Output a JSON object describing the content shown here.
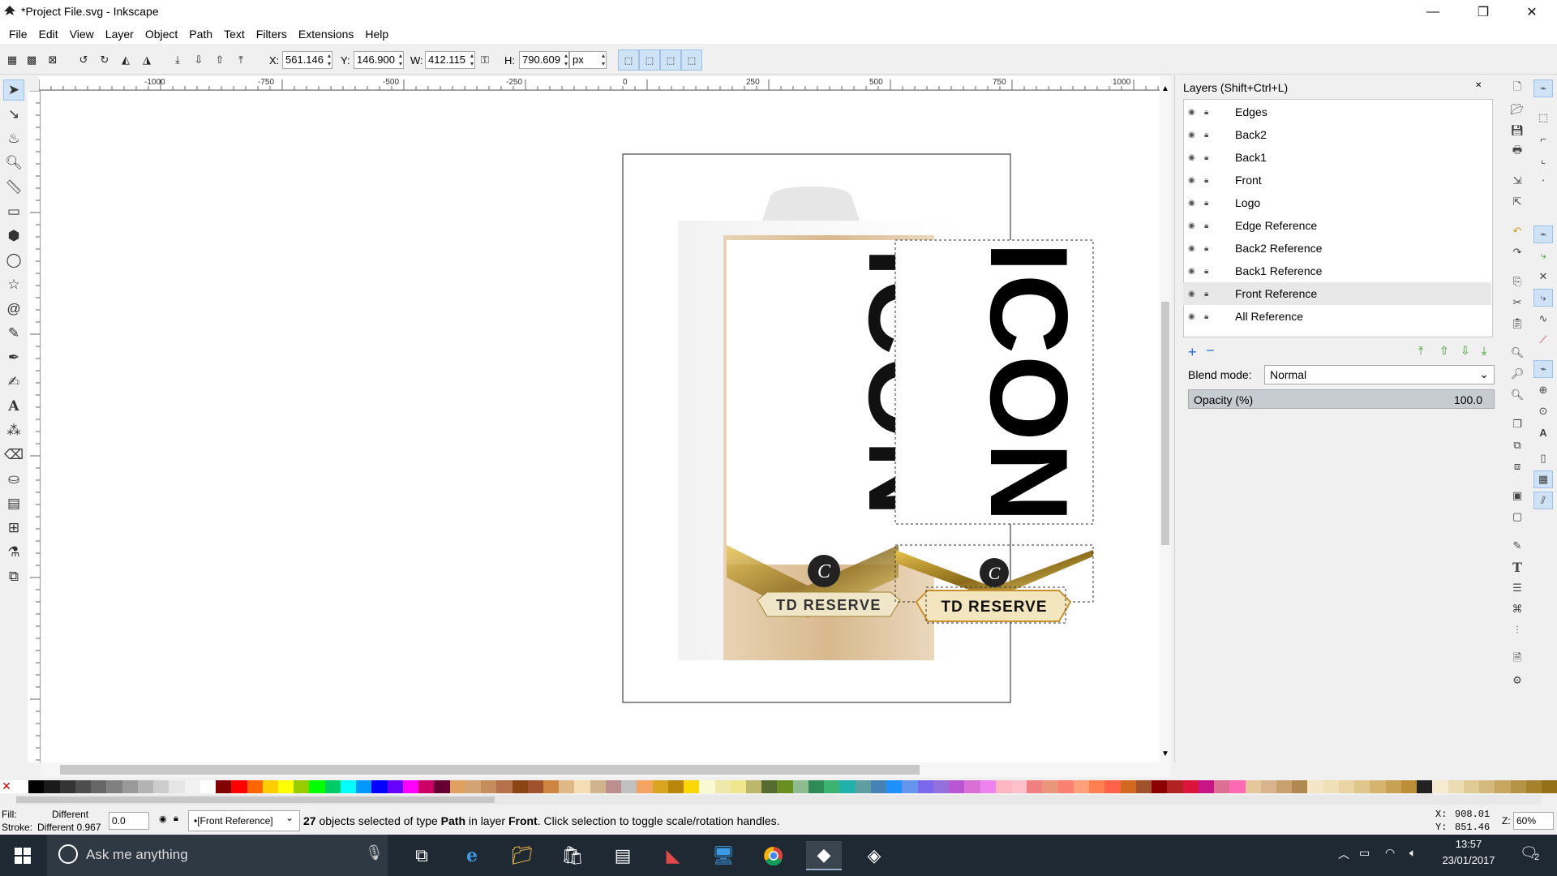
{
  "window": {
    "title": "*Project File.svg - Inkscape",
    "minimize": "—",
    "maximize": "❐",
    "close": "✕"
  },
  "menu": [
    "File",
    "Edit",
    "View",
    "Layer",
    "Object",
    "Path",
    "Text",
    "Filters",
    "Extensions",
    "Help"
  ],
  "tool_controls": {
    "x_label": "X:",
    "x_value": "561.146",
    "y_label": "Y:",
    "y_value": "146.900",
    "w_label": "W:",
    "w_value": "412.115",
    "h_label": "H:",
    "h_value": "790.609",
    "unit": "px"
  },
  "ruler": {
    "h_ticks": [
      "-1000",
      "-750",
      "-500",
      "-250",
      "0",
      "250",
      "500",
      "750",
      "1000"
    ],
    "v_ticks": [
      "0",
      "100",
      "200",
      "300",
      "400",
      "500",
      "600",
      "700",
      "800",
      "900"
    ]
  },
  "artwork": {
    "left_word": "ICON",
    "left_label": "TD RESERVE",
    "right_word": "ICON",
    "right_label": "TD RESERVE",
    "badge": "C"
  },
  "layers_panel": {
    "title": "Layers (Shift+Ctrl+L)",
    "layers": [
      {
        "name": "Edges",
        "selected": false
      },
      {
        "name": "Back2",
        "selected": false
      },
      {
        "name": "Back1",
        "selected": false
      },
      {
        "name": "Front",
        "selected": false
      },
      {
        "name": "Logo",
        "selected": false
      },
      {
        "name": "Edge Reference",
        "selected": false
      },
      {
        "name": "Back2 Reference",
        "selected": false
      },
      {
        "name": "Back1 Reference",
        "selected": false
      },
      {
        "name": "Front Reference",
        "selected": true
      },
      {
        "name": "All Reference",
        "selected": false
      }
    ],
    "add": "+",
    "remove": "−",
    "blend_label": "Blend mode:",
    "blend_value": "Normal",
    "opacity_label": "Opacity (%)",
    "opacity_value": "100.0"
  },
  "palette": [
    "#ffffff",
    "#000000",
    "#1a1a1a",
    "#333333",
    "#4d4d4d",
    "#666666",
    "#808080",
    "#999999",
    "#b3b3b3",
    "#cccccc",
    "#e6e6e6",
    "#f2f2f2",
    "#ffffff",
    "#800000",
    "#ff0000",
    "#ff6600",
    "#ffcc00",
    "#ffff00",
    "#99cc00",
    "#00ff00",
    "#00cc66",
    "#00ffff",
    "#0099ff",
    "#0000ff",
    "#6600ff",
    "#ff00ff",
    "#cc0066",
    "#660033",
    "#e0a060",
    "#d4a373",
    "#c58c5c",
    "#b4714a",
    "#8b4513",
    "#a0522d",
    "#cd853f",
    "#deb887",
    "#f5deb3",
    "#d2b48c",
    "#bc8f8f",
    "#c0c0c0",
    "#f4a460",
    "#daa520",
    "#b8860b",
    "#ffd700",
    "#fafad2",
    "#eee8aa",
    "#f0e68c",
    "#bdb76b",
    "#556b2f",
    "#6b8e23",
    "#8fbc8f",
    "#2e8b57",
    "#3cb371",
    "#20b2aa",
    "#5f9ea0",
    "#4682b4",
    "#1e90ff",
    "#6495ed",
    "#7b68ee",
    "#9370db",
    "#ba55d3",
    "#da70d6",
    "#ee82ee",
    "#ffb6c1",
    "#ffc0cb",
    "#f08080",
    "#e9967a",
    "#fa8072",
    "#ffa07a",
    "#ff7f50",
    "#ff6347",
    "#d2691e",
    "#a0522d",
    "#8b0000",
    "#b22222",
    "#dc143c",
    "#c71585",
    "#db7093",
    "#ff69b4",
    "#e6c79c",
    "#d9b38c",
    "#c9a070",
    "#b08850",
    "#f5e6c8",
    "#efe0b9",
    "#e8d5a3",
    "#dfc68a",
    "#d4b46e",
    "#c9a152",
    "#bd8e38",
    "#222222",
    "#f7ecd0",
    "#ecdcb4",
    "#e0cb97",
    "#d3b97b",
    "#c5a760",
    "#b69446",
    "#a6822e",
    "#957018"
  ],
  "status": {
    "fill_label": "Fill:",
    "fill_value": "Different",
    "stroke_label": "Stroke:",
    "stroke_value": "Different 0.967",
    "opacity_field": "0.0",
    "layer_select": "•[Front Reference]",
    "message_count": "27",
    "message_mid": " objects selected of type ",
    "message_type": "Path",
    "message_mid2": " in layer ",
    "message_layer": "Front",
    "message_end": ". Click selection to toggle scale/rotation handles.",
    "cursor_x_label": "X:",
    "cursor_x": "908.01",
    "cursor_y_label": "Y:",
    "cursor_y": "851.46",
    "zoom_label": "Z:",
    "zoom": "60%"
  },
  "taskbar": {
    "search_placeholder": "Ask me anything",
    "time": "13:57",
    "date": "23/01/2017",
    "notifications": "2"
  }
}
